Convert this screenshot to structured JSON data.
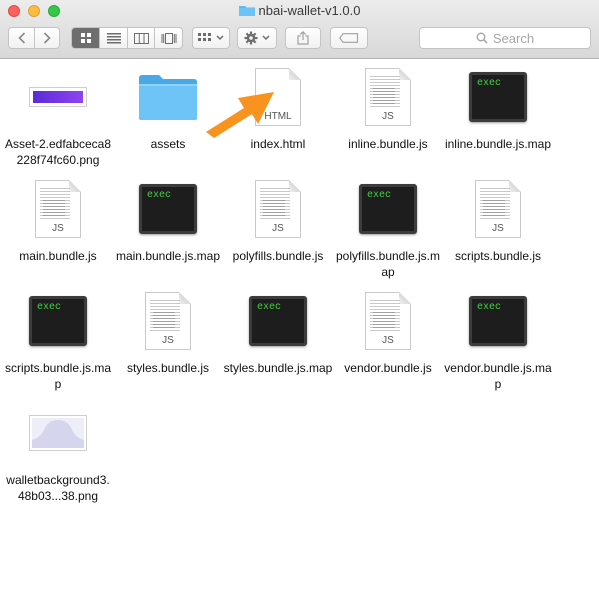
{
  "window": {
    "title": "nbai-wallet-v1.0.0"
  },
  "toolbar": {
    "search_placeholder": "Search"
  },
  "files": [
    {
      "name": "Asset-2.edfabceca8228f74fc60.png",
      "kind": "png-purple",
      "tag": ""
    },
    {
      "name": "assets",
      "kind": "folder",
      "tag": ""
    },
    {
      "name": "index.html",
      "kind": "doc",
      "tag": "HTML"
    },
    {
      "name": "inline.bundle.js",
      "kind": "doc",
      "tag": "JS"
    },
    {
      "name": "inline.bundle.js.map",
      "kind": "exec",
      "tag": "exec"
    },
    {
      "name": "main.bundle.js",
      "kind": "doc",
      "tag": "JS"
    },
    {
      "name": "main.bundle.js.map",
      "kind": "exec",
      "tag": "exec"
    },
    {
      "name": "polyfills.bundle.js",
      "kind": "doc",
      "tag": "JS"
    },
    {
      "name": "polyfills.bundle.js.map",
      "kind": "exec",
      "tag": "exec"
    },
    {
      "name": "scripts.bundle.js",
      "kind": "doc",
      "tag": "JS"
    },
    {
      "name": "scripts.bundle.js.map",
      "kind": "exec",
      "tag": "exec"
    },
    {
      "name": "styles.bundle.js",
      "kind": "doc",
      "tag": "JS"
    },
    {
      "name": "styles.bundle.js.map",
      "kind": "exec",
      "tag": "exec"
    },
    {
      "name": "vendor.bundle.js",
      "kind": "doc",
      "tag": "JS"
    },
    {
      "name": "vendor.bundle.js.map",
      "kind": "exec",
      "tag": "exec"
    },
    {
      "name": "walletbackground3.48b03...38.png",
      "kind": "png-bg",
      "tag": ""
    }
  ],
  "colors": {
    "annotation_arrow": "#f7931e",
    "folder": "#5fb8f0",
    "exec_text": "#3fd43f"
  },
  "icons": {
    "back": "chevron-left-icon",
    "forward": "chevron-right-icon",
    "view_icons": "icon-view-icon",
    "view_list": "list-view-icon",
    "view_columns": "column-view-icon",
    "view_coverflow": "coverflow-view-icon",
    "arrange": "arrange-icon",
    "action": "gear-icon",
    "share": "share-icon",
    "tags": "tag-icon",
    "search": "search-icon"
  }
}
